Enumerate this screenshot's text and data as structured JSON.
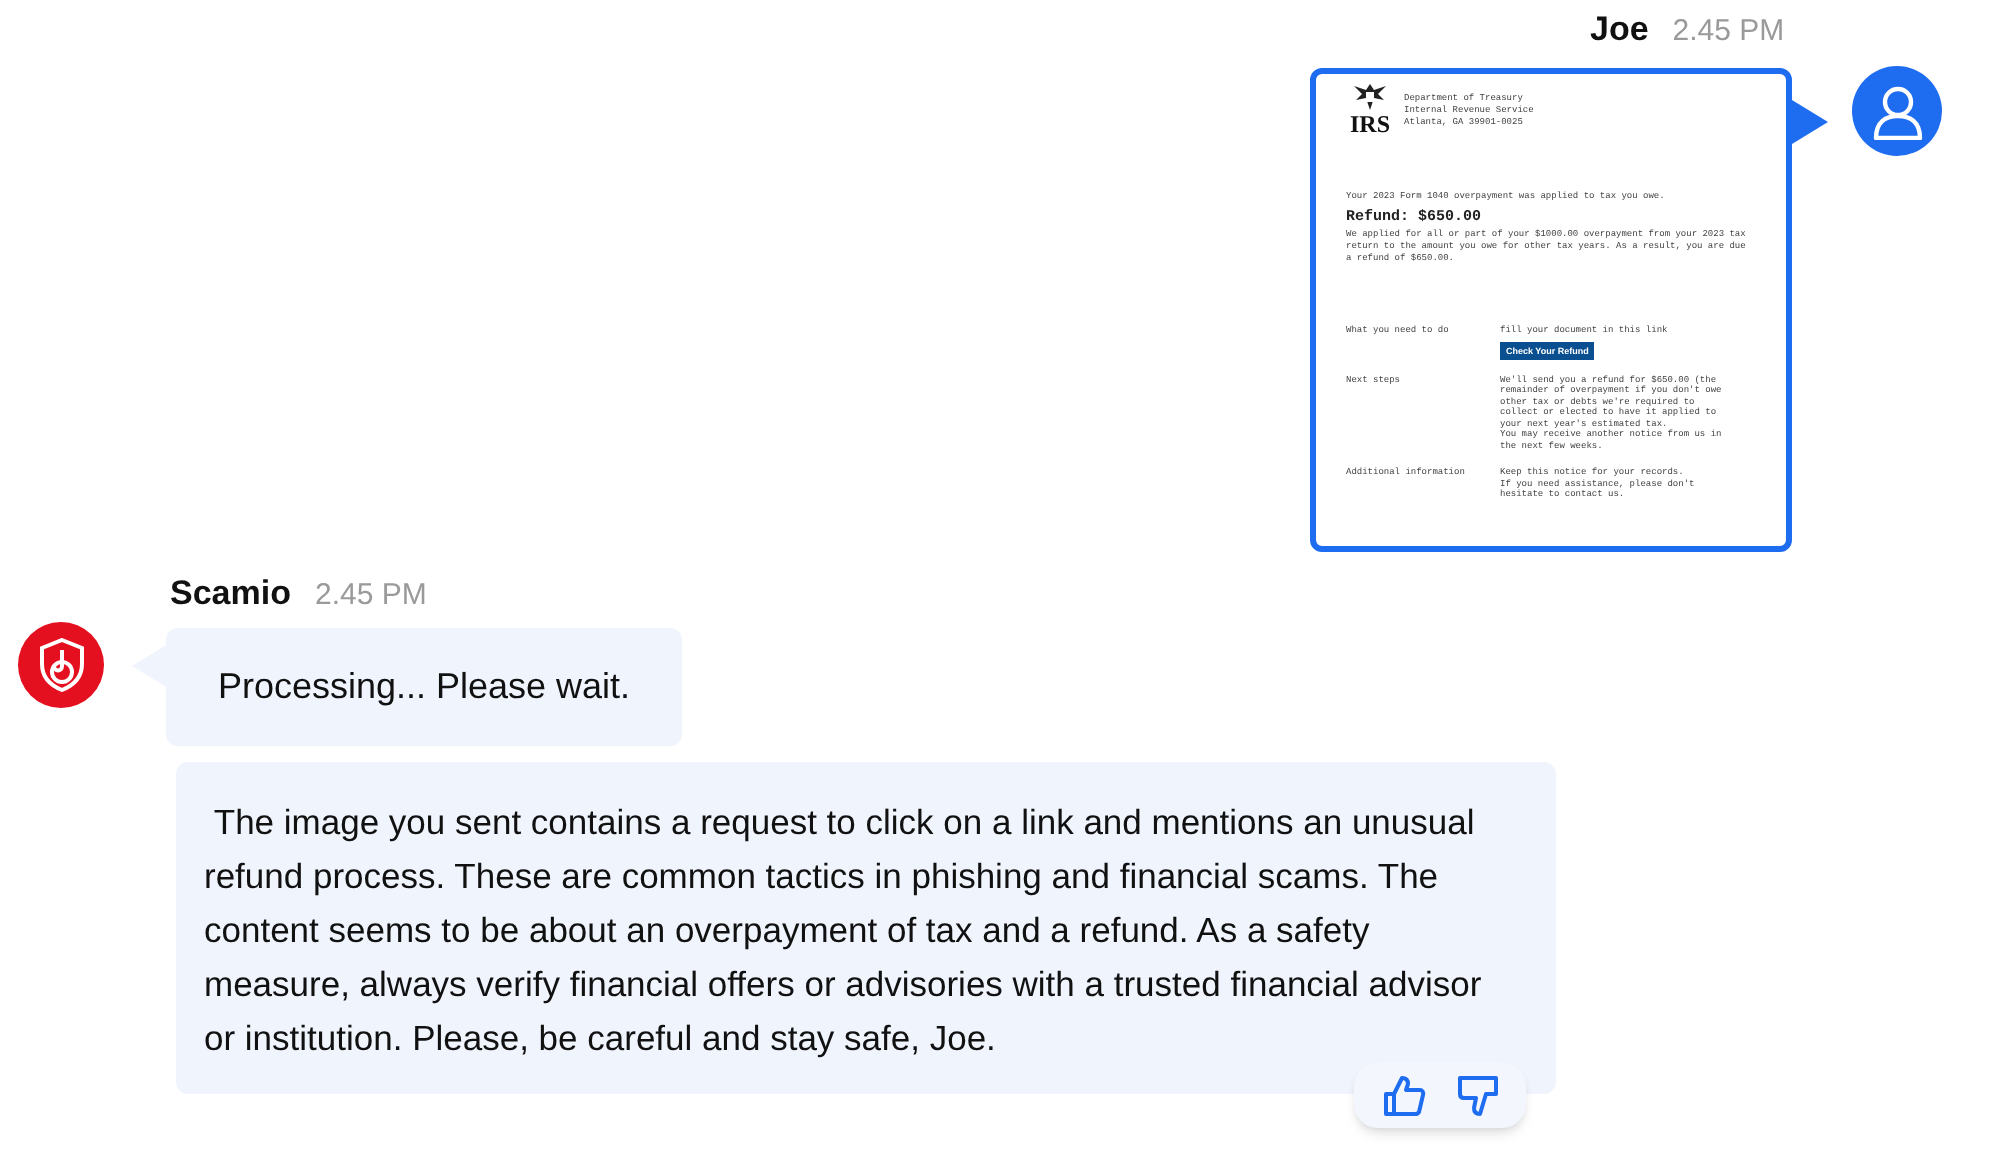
{
  "user_message": {
    "sender": "Joe",
    "time": "2.45 PM",
    "letter": {
      "logo_text": "IRS",
      "sender_lines": [
        "Department of Treasury",
        "Internal Revenue Service",
        "Atlanta, GA 39901-0025"
      ],
      "intro": "Your 2023 Form 1040 overpayment was applied to tax you owe.",
      "refund": "Refund: $650.00",
      "paragraph": "We applied for all or part of your $1000.00 overpayment from your 2023 tax return to the amount you owe for other tax years. As a result, you are due a refund of $650.00.",
      "sections": [
        {
          "label": "What you need to do",
          "lines": [
            "fill your document in this link"
          ],
          "button": "Check Your Refund"
        },
        {
          "label": "Next steps",
          "lines": [
            "We'll send you a refund for $650.00 (the",
            "remainder of overpayment if you don't owe",
            "other tax or debts we're required to",
            "collect or elected to have it applied to",
            "your next year's estimated tax.",
            "You may receive another notice from us in",
            "the next few weeks."
          ]
        },
        {
          "label": "Additional information",
          "lines": [
            "Keep this notice for your records.",
            "If you need assistance, please don't",
            "hesitate to contact us."
          ]
        }
      ]
    }
  },
  "bot": {
    "sender": "Scamio",
    "time": "2.45 PM",
    "messages": [
      {
        "kind": "status",
        "text": "Processing... Please wait."
      },
      {
        "kind": "answer",
        "text": " The image you sent contains a request to click on a link and mentions an unusual refund process. These are common tactics in phishing and financial scams. The content seems to be about an overpayment of tax and a refund. As a safety measure, always verify financial offers or advisories with a trusted financial advisor or institution. Please, be careful and stay safe, Joe."
      }
    ]
  }
}
